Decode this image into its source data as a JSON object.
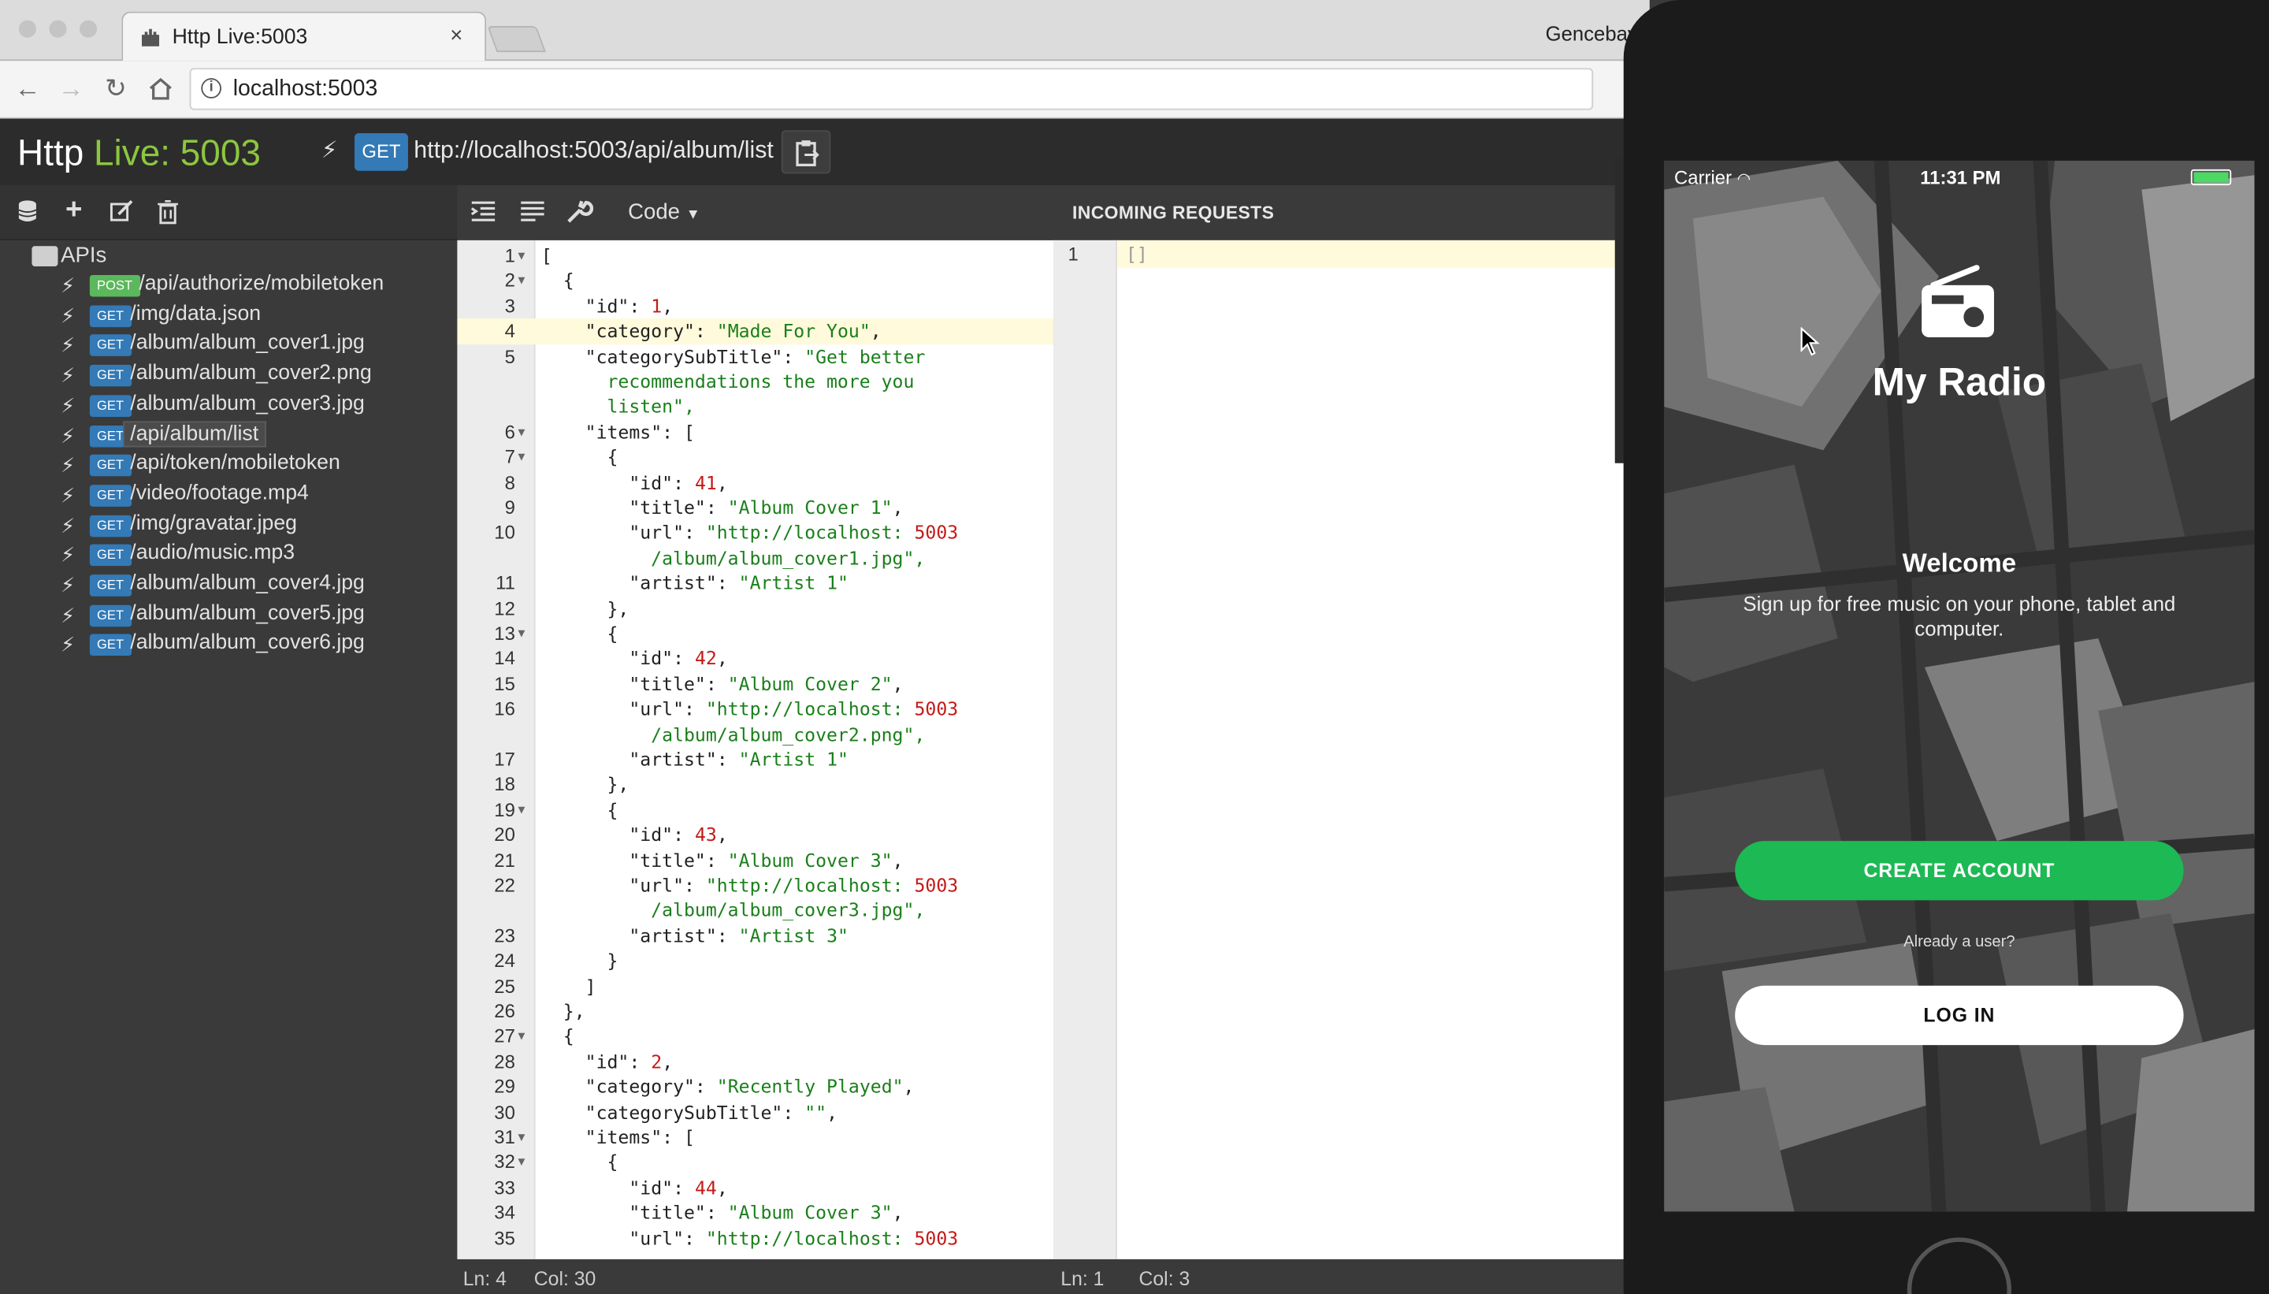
{
  "browser": {
    "tab_title": "Http Live:5003",
    "tab_close": "×",
    "profile_name": "Gencebay",
    "address": "localhost:5003"
  },
  "app": {
    "title_prefix": "Http ",
    "title_highlight": "Live:",
    "title_port": " 5003",
    "current_method": "GET",
    "current_url": "http://localhost:5003/api/album/list",
    "colors": {
      "accent": "#8dc63f",
      "get": "#337ab7",
      "post": "#5cb85c"
    }
  },
  "sidebar": {
    "root_label": "APIs",
    "tool_icons": [
      "database-icon",
      "plus-icon",
      "edit-icon",
      "trash-icon"
    ],
    "items": [
      {
        "method": "POST",
        "path": "/api/authorize/mobiletoken"
      },
      {
        "method": "GET",
        "path": "/img/data.json"
      },
      {
        "method": "GET",
        "path": "/album/album_cover1.jpg"
      },
      {
        "method": "GET",
        "path": "/album/album_cover2.png"
      },
      {
        "method": "GET",
        "path": "/album/album_cover3.jpg"
      },
      {
        "method": "GET",
        "path": "/api/album/list",
        "selected": true
      },
      {
        "method": "GET",
        "path": "/api/token/mobiletoken"
      },
      {
        "method": "GET",
        "path": "/video/footage.mp4"
      },
      {
        "method": "GET",
        "path": "/img/gravatar.jpeg"
      },
      {
        "method": "GET",
        "path": "/audio/music.mp3"
      },
      {
        "method": "GET",
        "path": "/album/album_cover4.jpg"
      },
      {
        "method": "GET",
        "path": "/album/album_cover5.jpg"
      },
      {
        "method": "GET",
        "path": "/album/album_cover6.jpg"
      }
    ]
  },
  "editor": {
    "menu_label": "Code",
    "incoming_title": "INCOMING REQUESTS",
    "active_line": 4,
    "lines": [
      {
        "n": "1",
        "fold": true,
        "t": "["
      },
      {
        "n": "2",
        "fold": true,
        "t": "  {"
      },
      {
        "n": "3",
        "t": "    \"id\": 1,"
      },
      {
        "n": "4",
        "t": "    \"category\": \"Made For You\","
      },
      {
        "n": "5",
        "t": "    \"categorySubTitle\":\"Get better"
      },
      {
        "n": "",
        "t": "      recommendations the more you"
      },
      {
        "n": "",
        "t": "      listen\","
      },
      {
        "n": "6",
        "fold": true,
        "t": "    \"items\": ["
      },
      {
        "n": "7",
        "fold": true,
        "t": "      {"
      },
      {
        "n": "8",
        "t": "        \"id\": 41,"
      },
      {
        "n": "9",
        "t": "        \"title\": \"Album Cover 1\","
      },
      {
        "n": "10",
        "t": "        \"url\": \"http://localhost:5003"
      },
      {
        "n": "",
        "t": "          /album/album_cover1.jpg\","
      },
      {
        "n": "11",
        "t": "        \"artist\": \"Artist 1\""
      },
      {
        "n": "12",
        "t": "      },"
      },
      {
        "n": "13",
        "fold": true,
        "t": "      {"
      },
      {
        "n": "14",
        "t": "        \"id\": 42,"
      },
      {
        "n": "15",
        "t": "        \"title\": \"Album Cover 2\","
      },
      {
        "n": "16",
        "t": "        \"url\": \"http://localhost:5003"
      },
      {
        "n": "",
        "t": "          /album/album_cover2.png\","
      },
      {
        "n": "17",
        "t": "        \"artist\": \"Artist 1\""
      },
      {
        "n": "18",
        "t": "      },"
      },
      {
        "n": "19",
        "fold": true,
        "t": "      {"
      },
      {
        "n": "20",
        "t": "        \"id\": 43,"
      },
      {
        "n": "21",
        "t": "        \"title\": \"Album Cover 3\","
      },
      {
        "n": "22",
        "t": "        \"url\": \"http://localhost:5003"
      },
      {
        "n": "",
        "t": "          /album/album_cover3.jpg\","
      },
      {
        "n": "23",
        "t": "        \"artist\": \"Artist 3\""
      },
      {
        "n": "24",
        "t": "      }"
      },
      {
        "n": "25",
        "t": "    ]"
      },
      {
        "n": "26",
        "t": "  },"
      },
      {
        "n": "27",
        "fold": true,
        "t": "  {"
      },
      {
        "n": "28",
        "t": "    \"id\": 2,"
      },
      {
        "n": "29",
        "t": "    \"category\": \"Recently Played\","
      },
      {
        "n": "30",
        "t": "    \"categorySubTitle\": \"\","
      },
      {
        "n": "31",
        "fold": true,
        "t": "    \"items\": ["
      },
      {
        "n": "32",
        "fold": true,
        "t": "      {"
      },
      {
        "n": "33",
        "t": "        \"id\": 44,"
      },
      {
        "n": "34",
        "t": "        \"title\": \"Album Cover 3\","
      },
      {
        "n": "35",
        "t": "        \"url\": \"http://localhost:5003"
      }
    ],
    "status_line": "Ln: 4",
    "status_col": "Col: 30"
  },
  "incoming": {
    "line": "1",
    "text": "[]",
    "status_line": "Ln: 1",
    "status_col": "Col: 3"
  },
  "phone": {
    "carrier": "Carrier",
    "time": "11:31 PM",
    "app_name": "My Radio",
    "welcome": "Welcome",
    "tagline": "Sign up for free music on your phone, tablet and computer.",
    "create_account": "CREATE ACCOUNT",
    "already_user": "Already a user?",
    "login": "LOG IN",
    "colors": {
      "primary": "#1db954"
    }
  }
}
